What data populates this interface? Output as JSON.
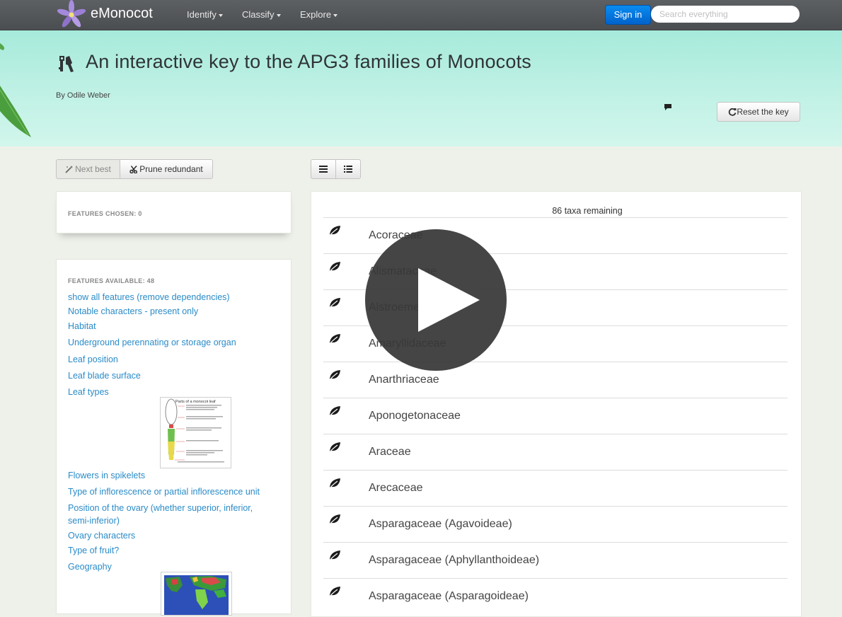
{
  "navbar": {
    "brand": "eMonocot",
    "menus": [
      {
        "label": "Identify"
      },
      {
        "label": "Classify"
      },
      {
        "label": "Explore"
      }
    ],
    "signin_label": "Sign in",
    "search_placeholder": "Search everything"
  },
  "header": {
    "title": "An interactive key to the APG3 families of Monocots",
    "byline": "By Odile Weber",
    "reset_label": "Reset the key"
  },
  "toolbar": {
    "next_best_label": "Next best",
    "prune_label": "Prune redundant"
  },
  "features_chosen": {
    "heading": "FEATURES CHOSEN: 0"
  },
  "features_available": {
    "heading": "FEATURES AVAILABLE: 48",
    "items": [
      "show all features (remove dependencies)",
      "Notable characters - present only",
      "Habitat",
      "Underground perennating or storage organ",
      "Leaf position",
      "Leaf blade surface",
      "Leaf types",
      "Flowers in spikelets",
      "Type of inflorescence or partial inflorescence unit",
      "Position of the ovary (whether superior, inferior,",
      "semi-inferior)",
      "Ovary characters",
      "Type of fruit?",
      "Geography"
    ],
    "leaf_thumb_title": "Parts of a monocot leaf"
  },
  "results": {
    "count_label": "86 taxa remaining",
    "taxa": [
      "Acoraceae",
      "Alismataceae",
      "Alstroemeriaceae",
      "Amaryllidaceae",
      "Anarthriaceae",
      "Aponogetonaceae",
      "Araceae",
      "Arecaceae",
      "Asparagaceae (Agavoideae)",
      "Asparagaceae (Aphyllanthoideae)",
      "Asparagaceae (Asparagoideae)"
    ]
  },
  "colors": {
    "navbar": "#4f5255",
    "header_band": "#b6eee1",
    "link": "#2a8bc8",
    "signin": "#0a7fe0",
    "brand_flower": "#9b7fd4"
  },
  "icons": {
    "logo": "flower-logo-icon",
    "key": "key-icon",
    "comment": "comment-icon",
    "reset": "refresh-icon",
    "next_best": "magic-wand-icon",
    "prune": "scissors-icon",
    "list_view": "list-icon",
    "detail_view": "detail-list-icon",
    "taxon": "leaf-icon",
    "video": "play-icon"
  }
}
